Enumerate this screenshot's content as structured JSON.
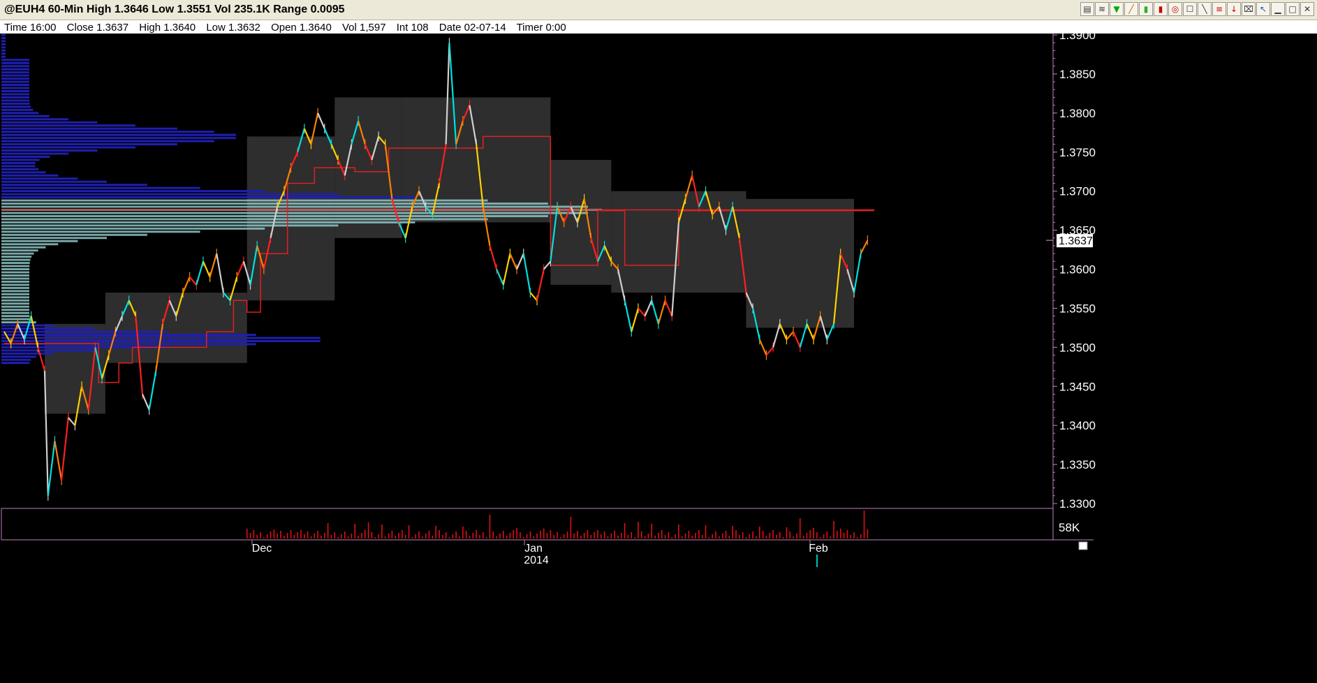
{
  "window": {
    "title": "@EUH4 60-Min High 1.3646 Low 1.3551 Vol 235.1K Range 0.0095"
  },
  "toolbar": {
    "icons": [
      "chart-style-icon",
      "lines-icon",
      "indicator-icon",
      "draw-icon",
      "bar-icon",
      "bar-red-icon",
      "alarm-icon",
      "study-icon",
      "trendline-icon",
      "fib-icon",
      "arrow-down-icon",
      "trash-icon",
      "cursor-icon",
      "minimize-icon",
      "maximize-icon",
      "close-icon"
    ]
  },
  "data_line": {
    "time": "Time 16:00",
    "close": "Close 1.3637",
    "high": "High 1.3640",
    "low": "Low 1.3632",
    "open": "Open 1.3640",
    "vol": "Vol 1,597",
    "int": "Int 108",
    "date": "Date 02-07-14",
    "timer": "Timer 0:00"
  },
  "colors": {
    "background": "#000000",
    "axis": "#c080c0",
    "profile_blue": "#1f1fb0",
    "profile_teal": "#8ec4c4",
    "value_area": "#2e2e2e",
    "vwap_line": "#e02020",
    "last_price_box": "#ffffff"
  },
  "chart_data": {
    "type": "line",
    "symbol": "@EUH4",
    "interval": "60-Min",
    "y_ticks": [
      "1.3900",
      "1.3850",
      "1.3800",
      "1.3750",
      "1.3700",
      "1.3650",
      "1.3600",
      "1.3550",
      "1.3500",
      "1.3450",
      "1.3400",
      "1.3350",
      "1.3300"
    ],
    "ylim": [
      1.33,
      1.39
    ],
    "x_labels": [
      "Dec",
      "Jan",
      "2014",
      "Feb"
    ],
    "last_price": "1.3637",
    "volume_label": "58K",
    "price_series": [
      {
        "t": 0,
        "v": 1.352
      },
      {
        "t": 2,
        "v": 1.3505
      },
      {
        "t": 4,
        "v": 1.353
      },
      {
        "t": 6,
        "v": 1.351
      },
      {
        "t": 8,
        "v": 1.354
      },
      {
        "t": 10,
        "v": 1.35
      },
      {
        "t": 12,
        "v": 1.347
      },
      {
        "t": 13,
        "v": 1.331
      },
      {
        "t": 15,
        "v": 1.338
      },
      {
        "t": 17,
        "v": 1.333
      },
      {
        "t": 19,
        "v": 1.341
      },
      {
        "t": 21,
        "v": 1.34
      },
      {
        "t": 23,
        "v": 1.345
      },
      {
        "t": 25,
        "v": 1.342
      },
      {
        "t": 27,
        "v": 1.35
      },
      {
        "t": 29,
        "v": 1.346
      },
      {
        "t": 31,
        "v": 1.349
      },
      {
        "t": 33,
        "v": 1.352
      },
      {
        "t": 35,
        "v": 1.354
      },
      {
        "t": 37,
        "v": 1.356
      },
      {
        "t": 39,
        "v": 1.354
      },
      {
        "t": 41,
        "v": 1.344
      },
      {
        "t": 43,
        "v": 1.342
      },
      {
        "t": 45,
        "v": 1.347
      },
      {
        "t": 47,
        "v": 1.353
      },
      {
        "t": 49,
        "v": 1.356
      },
      {
        "t": 51,
        "v": 1.354
      },
      {
        "t": 53,
        "v": 1.357
      },
      {
        "t": 55,
        "v": 1.359
      },
      {
        "t": 57,
        "v": 1.358
      },
      {
        "t": 59,
        "v": 1.361
      },
      {
        "t": 61,
        "v": 1.359
      },
      {
        "t": 63,
        "v": 1.362
      },
      {
        "t": 65,
        "v": 1.357
      },
      {
        "t": 67,
        "v": 1.356
      },
      {
        "t": 69,
        "v": 1.359
      },
      {
        "t": 71,
        "v": 1.361
      },
      {
        "t": 73,
        "v": 1.358
      },
      {
        "t": 75,
        "v": 1.363
      },
      {
        "t": 77,
        "v": 1.36
      },
      {
        "t": 79,
        "v": 1.364
      },
      {
        "t": 81,
        "v": 1.368
      },
      {
        "t": 83,
        "v": 1.37
      },
      {
        "t": 85,
        "v": 1.373
      },
      {
        "t": 87,
        "v": 1.375
      },
      {
        "t": 89,
        "v": 1.378
      },
      {
        "t": 91,
        "v": 1.376
      },
      {
        "t": 93,
        "v": 1.38
      },
      {
        "t": 95,
        "v": 1.378
      },
      {
        "t": 97,
        "v": 1.376
      },
      {
        "t": 99,
        "v": 1.374
      },
      {
        "t": 101,
        "v": 1.372
      },
      {
        "t": 103,
        "v": 1.376
      },
      {
        "t": 105,
        "v": 1.379
      },
      {
        "t": 107,
        "v": 1.376
      },
      {
        "t": 109,
        "v": 1.374
      },
      {
        "t": 111,
        "v": 1.377
      },
      {
        "t": 113,
        "v": 1.376
      },
      {
        "t": 115,
        "v": 1.369
      },
      {
        "t": 117,
        "v": 1.366
      },
      {
        "t": 119,
        "v": 1.364
      },
      {
        "t": 121,
        "v": 1.368
      },
      {
        "t": 123,
        "v": 1.37
      },
      {
        "t": 125,
        "v": 1.368
      },
      {
        "t": 127,
        "v": 1.367
      },
      {
        "t": 129,
        "v": 1.371
      },
      {
        "t": 131,
        "v": 1.376
      },
      {
        "t": 132,
        "v": 1.389
      },
      {
        "t": 134,
        "v": 1.376
      },
      {
        "t": 136,
        "v": 1.379
      },
      {
        "t": 138,
        "v": 1.381
      },
      {
        "t": 140,
        "v": 1.376
      },
      {
        "t": 142,
        "v": 1.368
      },
      {
        "t": 144,
        "v": 1.363
      },
      {
        "t": 146,
        "v": 1.36
      },
      {
        "t": 148,
        "v": 1.358
      },
      {
        "t": 150,
        "v": 1.362
      },
      {
        "t": 152,
        "v": 1.36
      },
      {
        "t": 154,
        "v": 1.362
      },
      {
        "t": 156,
        "v": 1.357
      },
      {
        "t": 158,
        "v": 1.356
      },
      {
        "t": 160,
        "v": 1.36
      },
      {
        "t": 162,
        "v": 1.361
      },
      {
        "t": 164,
        "v": 1.368
      },
      {
        "t": 166,
        "v": 1.366
      },
      {
        "t": 168,
        "v": 1.368
      },
      {
        "t": 170,
        "v": 1.366
      },
      {
        "t": 172,
        "v": 1.369
      },
      {
        "t": 174,
        "v": 1.364
      },
      {
        "t": 176,
        "v": 1.361
      },
      {
        "t": 178,
        "v": 1.363
      },
      {
        "t": 180,
        "v": 1.361
      },
      {
        "t": 182,
        "v": 1.36
      },
      {
        "t": 184,
        "v": 1.356
      },
      {
        "t": 186,
        "v": 1.352
      },
      {
        "t": 188,
        "v": 1.355
      },
      {
        "t": 190,
        "v": 1.354
      },
      {
        "t": 192,
        "v": 1.356
      },
      {
        "t": 194,
        "v": 1.353
      },
      {
        "t": 196,
        "v": 1.356
      },
      {
        "t": 198,
        "v": 1.354
      },
      {
        "t": 200,
        "v": 1.366
      },
      {
        "t": 202,
        "v": 1.369
      },
      {
        "t": 204,
        "v": 1.372
      },
      {
        "t": 206,
        "v": 1.368
      },
      {
        "t": 208,
        "v": 1.37
      },
      {
        "t": 210,
        "v": 1.367
      },
      {
        "t": 212,
        "v": 1.368
      },
      {
        "t": 214,
        "v": 1.365
      },
      {
        "t": 216,
        "v": 1.368
      },
      {
        "t": 218,
        "v": 1.364
      },
      {
        "t": 220,
        "v": 1.357
      },
      {
        "t": 222,
        "v": 1.355
      },
      {
        "t": 224,
        "v": 1.351
      },
      {
        "t": 226,
        "v": 1.349
      },
      {
        "t": 228,
        "v": 1.35
      },
      {
        "t": 230,
        "v": 1.353
      },
      {
        "t": 232,
        "v": 1.351
      },
      {
        "t": 234,
        "v": 1.352
      },
      {
        "t": 236,
        "v": 1.35
      },
      {
        "t": 238,
        "v": 1.353
      },
      {
        "t": 240,
        "v": 1.351
      },
      {
        "t": 242,
        "v": 1.354
      },
      {
        "t": 244,
        "v": 1.351
      },
      {
        "t": 246,
        "v": 1.353
      },
      {
        "t": 248,
        "v": 1.362
      },
      {
        "t": 250,
        "v": 1.36
      },
      {
        "t": 252,
        "v": 1.357
      },
      {
        "t": 254,
        "v": 1.362
      },
      {
        "t": 256,
        "v": 1.3637
      }
    ],
    "vwap_steps": [
      {
        "t": 0,
        "v": 1.3505
      },
      {
        "t": 28,
        "v": 1.3455
      },
      {
        "t": 34,
        "v": 1.348
      },
      {
        "t": 38,
        "v": 1.35
      },
      {
        "t": 60,
        "v": 1.352
      },
      {
        "t": 68,
        "v": 1.356
      },
      {
        "t": 72,
        "v": 1.3545
      },
      {
        "t": 76,
        "v": 1.362
      },
      {
        "t": 84,
        "v": 1.371
      },
      {
        "t": 92,
        "v": 1.373
      },
      {
        "t": 104,
        "v": 1.3725
      },
      {
        "t": 114,
        "v": 1.3755
      },
      {
        "t": 135,
        "v": 1.3755
      },
      {
        "t": 142,
        "v": 1.377
      },
      {
        "t": 158,
        "v": 1.377
      },
      {
        "t": 162,
        "v": 1.3605
      },
      {
        "t": 176,
        "v": 1.3675
      },
      {
        "t": 184,
        "v": 1.3605
      },
      {
        "t": 196,
        "v": 1.3605
      },
      {
        "t": 200,
        "v": 1.3675
      },
      {
        "t": 258,
        "v": 1.3675
      }
    ],
    "profile_line": 1.3676,
    "grid": false
  }
}
